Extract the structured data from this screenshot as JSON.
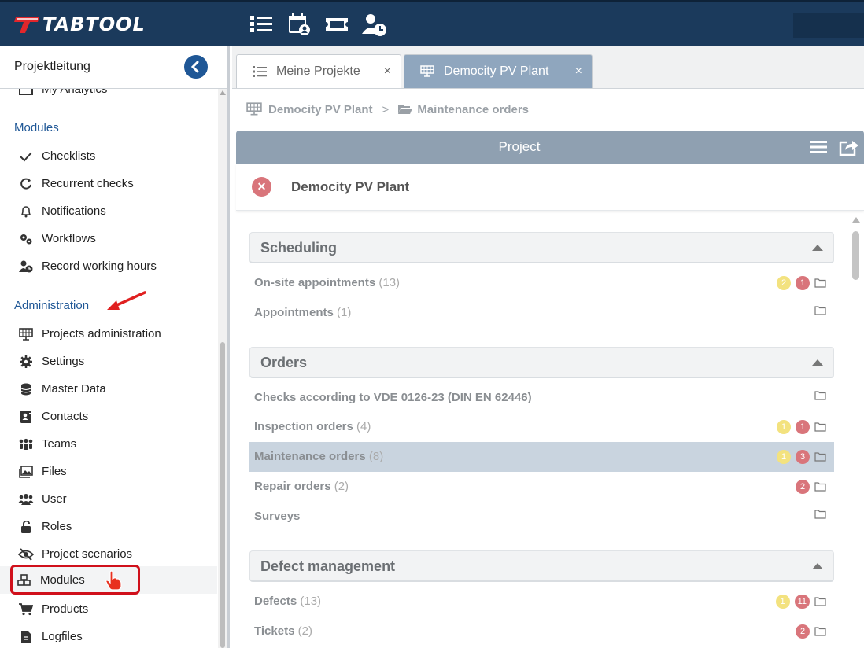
{
  "app": {
    "logo_text": "TABTOOL",
    "brand_color": "#1b3a5c",
    "accent_color": "#1f5796"
  },
  "topbar": {
    "icons": [
      "list-icon",
      "calendar-user-icon",
      "ticket-icon",
      "user-clock-icon"
    ]
  },
  "sidebar": {
    "title": "Projektleitung",
    "partial_item": "My Analytics",
    "section_modules": "Modules",
    "modules_items": [
      {
        "label": "Checklists",
        "icon": "check-icon"
      },
      {
        "label": "Recurrent checks",
        "icon": "refresh-icon"
      },
      {
        "label": "Notifications",
        "icon": "bell-icon"
      },
      {
        "label": "Workflows",
        "icon": "cogs-icon"
      },
      {
        "label": "Record working hours",
        "icon": "user-clock-icon"
      }
    ],
    "section_admin": "Administration",
    "admin_items": [
      {
        "label": "Projects administration",
        "icon": "solar-panel-icon"
      },
      {
        "label": "Settings",
        "icon": "gear-icon"
      },
      {
        "label": "Master Data",
        "icon": "database-icon"
      },
      {
        "label": "Contacts",
        "icon": "address-card-icon"
      },
      {
        "label": "Teams",
        "icon": "team-icon"
      },
      {
        "label": "Files",
        "icon": "image-icon"
      },
      {
        "label": "User",
        "icon": "users-icon"
      },
      {
        "label": "Roles",
        "icon": "unlock-icon"
      },
      {
        "label": "Project scenarios",
        "icon": "eye-slash-icon"
      },
      {
        "label": "Modules",
        "icon": "cubes-icon"
      },
      {
        "label": "Products",
        "icon": "cart-icon"
      },
      {
        "label": "Logfiles",
        "icon": "file-icon"
      }
    ]
  },
  "tabs": [
    {
      "label": "Meine Projekte",
      "close": "×"
    },
    {
      "label": "Democity PV Plant",
      "close": "×"
    }
  ],
  "breadcrumb": {
    "project": "Democity PV Plant",
    "separator": ">",
    "current": "Maintenance orders"
  },
  "panel": {
    "title": "Project",
    "project_name": "Democity PV Plant",
    "close_symbol": "✕"
  },
  "groups": [
    {
      "title": "Scheduling",
      "rows": [
        {
          "label": "On-site appointments",
          "count": "(13)",
          "yellow": "2",
          "red": "1"
        },
        {
          "label": "Appointments",
          "count": "(1)",
          "yellow": "",
          "red": ""
        }
      ]
    },
    {
      "title": "Orders",
      "rows": [
        {
          "label": "Checks according to VDE 0126-23 (DIN EN 62446)",
          "count": "",
          "yellow": "",
          "red": ""
        },
        {
          "label": "Inspection orders",
          "count": "(4)",
          "yellow": "1",
          "red": "1"
        },
        {
          "label": "Maintenance orders",
          "count": "(8)",
          "yellow": "1",
          "red": "3",
          "selected": true
        },
        {
          "label": "Repair orders",
          "count": "(2)",
          "yellow": "",
          "red": "2"
        },
        {
          "label": "Surveys",
          "count": "",
          "yellow": "",
          "red": ""
        }
      ]
    },
    {
      "title": "Defect management",
      "rows": [
        {
          "label": "Defects",
          "count": "(13)",
          "yellow": "1",
          "red": "11"
        },
        {
          "label": "Tickets",
          "count": "(2)",
          "yellow": "",
          "red": "2"
        }
      ]
    }
  ]
}
